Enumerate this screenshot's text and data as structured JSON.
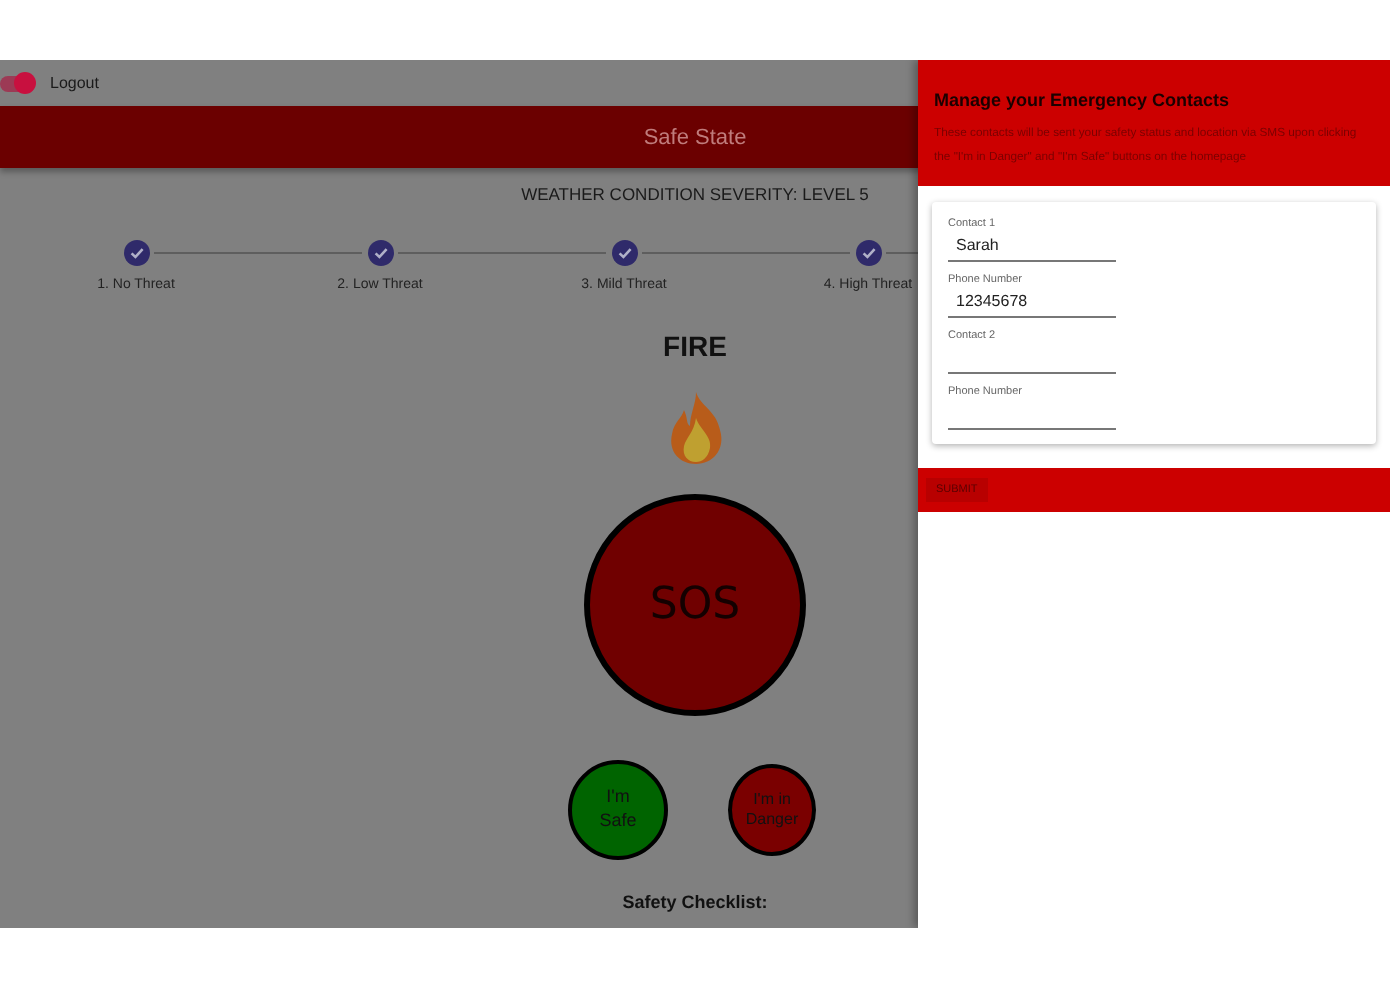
{
  "logout_toggle": {
    "label": "Logout",
    "on": true
  },
  "header": {
    "title": "Safe State"
  },
  "severity": "WEATHER CONDITION SEVERITY: LEVEL 5",
  "steps": [
    {
      "label": "1. No Threat",
      "completed": true
    },
    {
      "label": "2. Low Threat",
      "completed": true
    },
    {
      "label": "3. Mild Threat",
      "completed": true
    },
    {
      "label": "4. High Threat",
      "completed": true
    }
  ],
  "hazard": "FIRE",
  "sos_button": "SOS",
  "status_buttons": [
    {
      "label": "I'm Safe",
      "color": "#006400"
    },
    {
      "label": "I'm in Danger",
      "color": "#7a0000"
    }
  ],
  "checklist_title": "Safety Checklist:",
  "drawer": {
    "title": "Manage your Emergency Contacts",
    "description": "These contacts will be sent your safety status and location via SMS upon clicking the \"I'm in Danger\" and \"I'm Safe\" buttons on the homepage",
    "fields": [
      {
        "label": "Contact 1",
        "value": "Sarah"
      },
      {
        "label": "Phone Number",
        "value": "12345678"
      },
      {
        "label": "Contact 2"
      },
      {
        "label": "Phone Number"
      }
    ],
    "submit": "SUBMIT"
  }
}
